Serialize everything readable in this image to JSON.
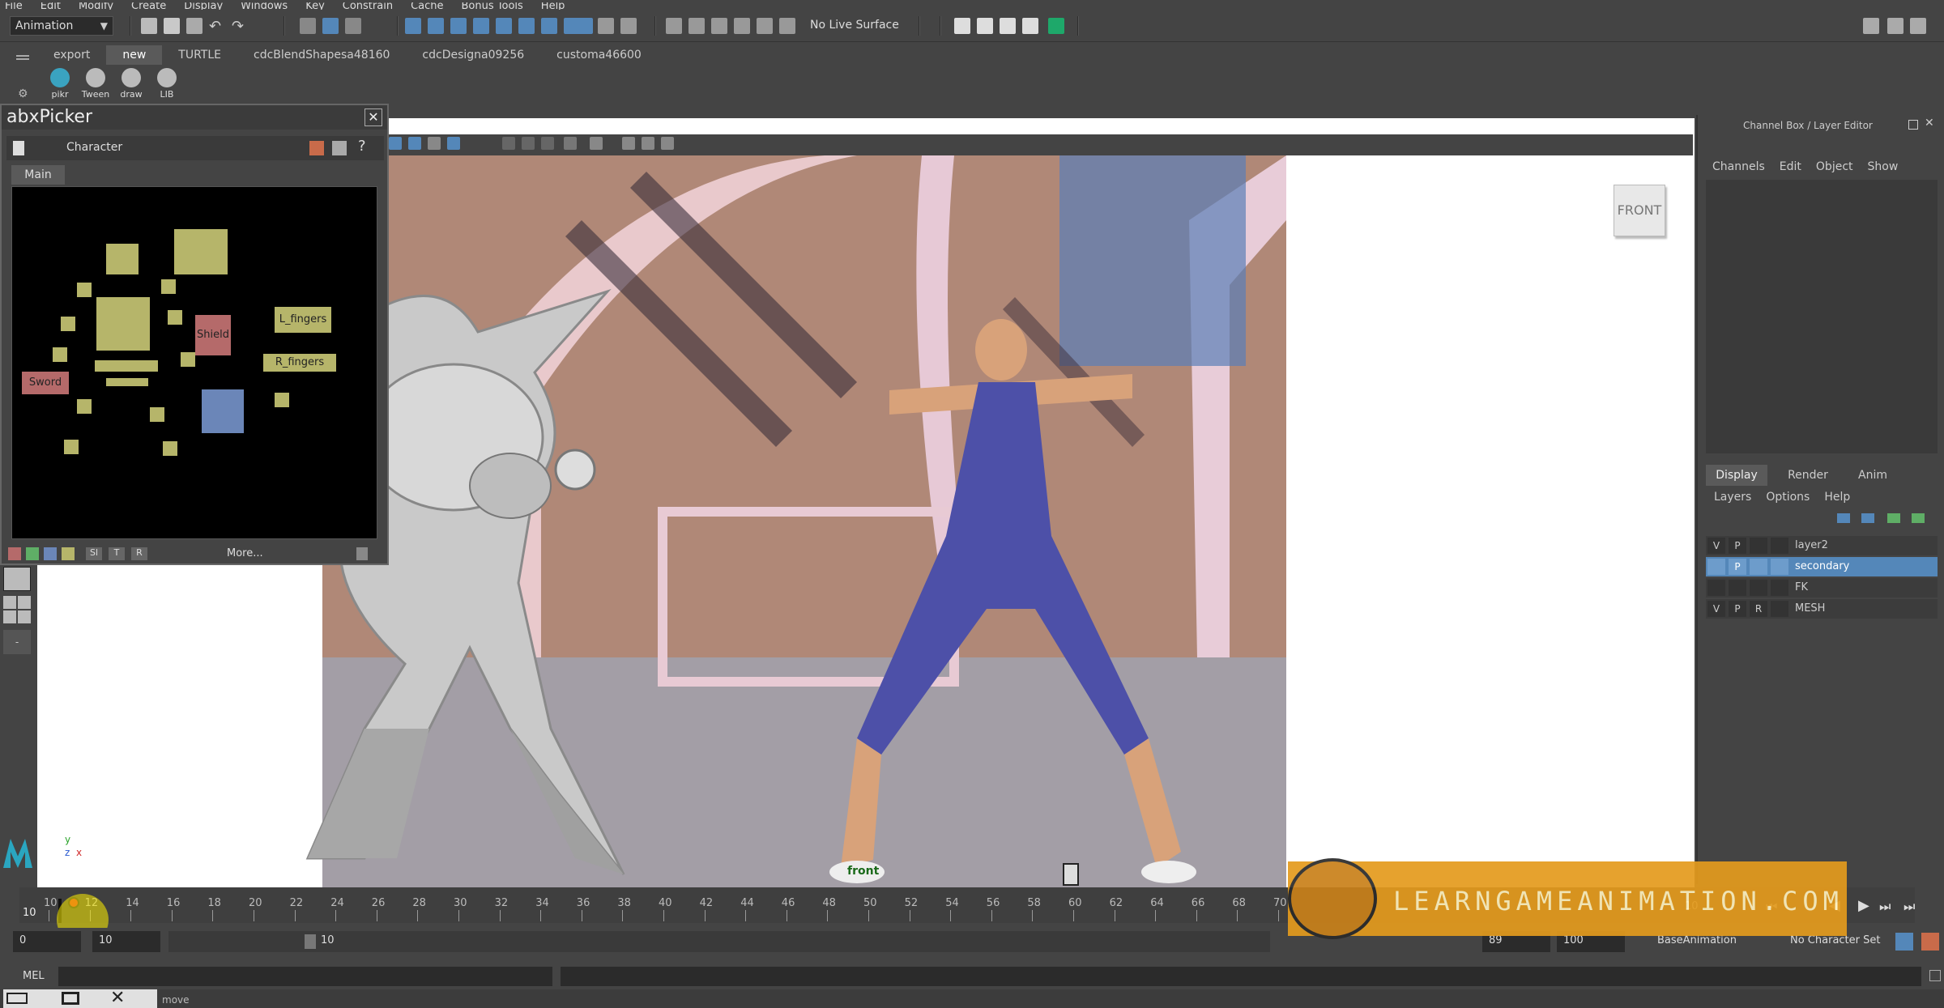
{
  "menu": [
    "File",
    "Edit",
    "Modify",
    "Create",
    "Display",
    "Windows",
    "Key",
    "Constrain",
    "Cache",
    "Bonus Tools",
    "Help"
  ],
  "status": {
    "mode": "Animation",
    "live_surface": "No Live Surface"
  },
  "shelf": {
    "tabs": [
      "export",
      "new",
      "TURTLE",
      "cdcBlendShapesa48160",
      "cdcDesigna09256",
      "customa46600"
    ],
    "active_tab": "new",
    "buttons": [
      "pikr",
      "Tween",
      "draw",
      "LIB"
    ]
  },
  "picker": {
    "window_title": "abxPicker",
    "character_label": "Character",
    "main_tab": "Main",
    "labels": {
      "shield": "Shield",
      "l_fingers": "L_fingers",
      "r_fingers": "R_fingers",
      "sword": "Sword"
    },
    "bottom_buttons": [
      "Sl",
      "T",
      "R"
    ],
    "more": "More..."
  },
  "viewport": {
    "camera_label": "front",
    "view_cube": "FRONT"
  },
  "channel_box": {
    "title": "Channel Box / Layer Editor",
    "menu": [
      "Channels",
      "Edit",
      "Object",
      "Show"
    ],
    "tabs": [
      "Display",
      "Render",
      "Anim"
    ],
    "active_tab": "Display",
    "layer_menu": [
      "Layers",
      "Options",
      "Help"
    ],
    "layers": [
      {
        "v": "V",
        "p": "P",
        "r": "",
        "name": "layer2",
        "selected": false
      },
      {
        "v": "",
        "p": "P",
        "r": "",
        "name": "secondary",
        "selected": true
      },
      {
        "v": "",
        "p": "",
        "r": "",
        "name": "FK",
        "selected": false
      },
      {
        "v": "V",
        "p": "P",
        "r": "R",
        "name": "MESH",
        "selected": false
      }
    ]
  },
  "timeline": {
    "ticks": [
      "10",
      "12",
      "14",
      "16",
      "18",
      "20",
      "22",
      "24",
      "26",
      "28",
      "30",
      "32",
      "34",
      "36",
      "38",
      "40",
      "42",
      "44",
      "46",
      "48",
      "50",
      "52",
      "54",
      "56",
      "58",
      "60",
      "62",
      "64",
      "66",
      "68",
      "70"
    ],
    "current_frame": "10",
    "range_start": "0",
    "playback_start": "10",
    "range_inner": "10",
    "range_end_a": "89",
    "range_end_b": "100",
    "anim_layer": "BaseAnimation",
    "character_set": "No Character Set",
    "right_frame": "10"
  },
  "command_line": {
    "label": "MEL",
    "help_text": "move"
  },
  "banner": {
    "text": "LEARNGAMEANIMATION.COM"
  },
  "colors": {
    "accent_blue": "#5487b9",
    "banner_orange": "#e49b1d",
    "picker_yellow": "#b6b56a",
    "picker_red": "#b56a6a",
    "picker_blue": "#6b86b8"
  }
}
